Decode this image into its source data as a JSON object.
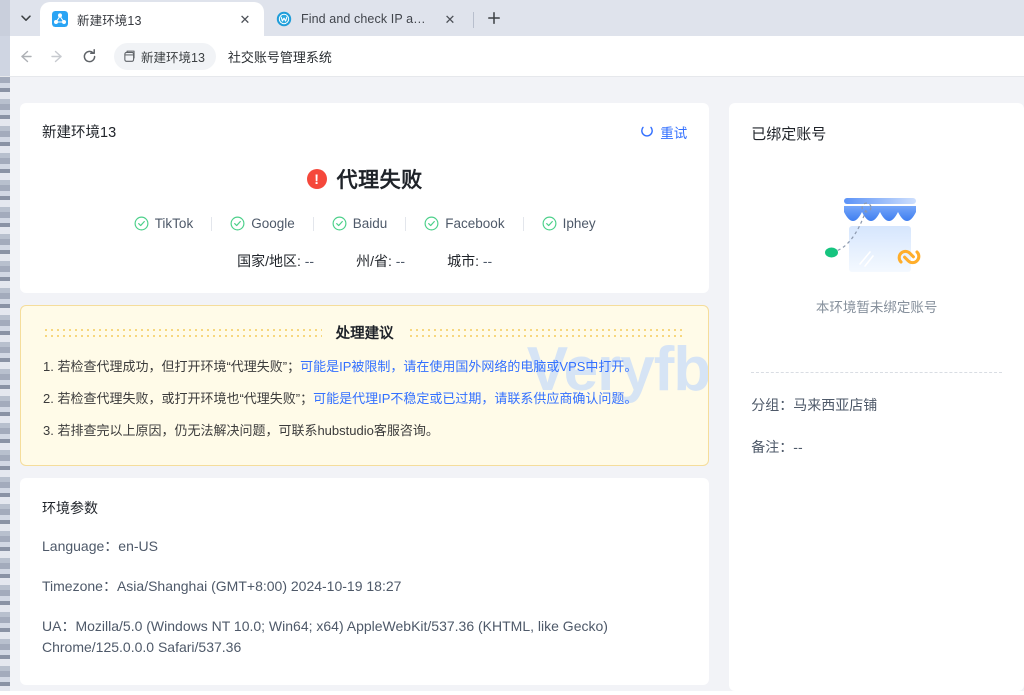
{
  "browser": {
    "tab_list_icon": "chevron-down-icon",
    "tabs": [
      {
        "title": "新建环境13",
        "favicon": "env-node-icon",
        "active": true,
        "close_label": "✕"
      },
      {
        "title": "Find and check IP address",
        "favicon": "whoer-globe-icon",
        "active": false,
        "close_label": "✕"
      }
    ],
    "new_tab_label": "+",
    "toolbar": {
      "back_label": "←",
      "forward_label": "→",
      "reload_label": "⟳",
      "env_pill_icon": "browser-window-icon",
      "env_pill_label": "新建环境13",
      "site_title": "社交账号管理系统"
    }
  },
  "main": {
    "status": {
      "env_name": "新建环境13",
      "retry_icon": "loading-spinner-icon",
      "retry_label": "重试",
      "error_icon": "exclamation-circle-icon",
      "error_text": "代理失败",
      "checks": [
        {
          "label": "TikTok",
          "icon": "check-circle-icon"
        },
        {
          "label": "Google",
          "icon": "check-circle-icon"
        },
        {
          "label": "Baidu",
          "icon": "check-circle-icon"
        },
        {
          "label": "Facebook",
          "icon": "check-circle-icon"
        },
        {
          "label": "Iphey",
          "icon": "check-circle-icon"
        }
      ],
      "geo": [
        {
          "label": "国家/地区:",
          "value": "--"
        },
        {
          "label": "州/省:",
          "value": "--"
        },
        {
          "label": "城市:",
          "value": "--"
        }
      ]
    },
    "advice": {
      "title": "处理建议",
      "watermark": "Veryfb",
      "items": [
        {
          "plain": "1. 若检查代理成功，但打开环境“代理失败”；",
          "highlight": "可能是IP被限制，请在使用国外网络的电脑或VPS中打开。"
        },
        {
          "plain": "2. 若检查代理失败，或打开环境也“代理失败”；",
          "highlight": "可能是代理IP不稳定或已过期，请联系供应商确认问题。"
        },
        {
          "plain": "3. 若排查完以上原因，仍无法解决问题，可联系hubstudio客服咨询。",
          "highlight": ""
        }
      ]
    },
    "params": {
      "title": "环境参数",
      "rows": [
        {
          "label": "Language：",
          "value": "en-US"
        },
        {
          "label": "Timezone：",
          "value": "Asia/Shanghai (GMT+8:00) 2024-10-19 18:27"
        },
        {
          "label": "UA：",
          "value": "Mozilla/5.0 (Windows NT 10.0; Win64; x64) AppleWebKit/537.36 (KHTML, like Gecko) Chrome/125.0.0.0 Safari/537.36"
        }
      ]
    }
  },
  "side": {
    "title": "已绑定账号",
    "illustration_icon": "shop-unlinked-illustration",
    "empty_text": "本环境暂未绑定账号",
    "fields": [
      {
        "label": "分组：",
        "value": "马来西亚店铺"
      },
      {
        "label": "备注：",
        "value": "--"
      }
    ]
  },
  "colors": {
    "accent_blue": "#3370ff",
    "error_red": "#f5483b",
    "success_green": "#4cd08a",
    "advice_bg": "#fffbe8",
    "advice_border": "#f5dd9b",
    "page_bg": "#f2f3f7",
    "watermark_blue": "#cfe0f7"
  }
}
